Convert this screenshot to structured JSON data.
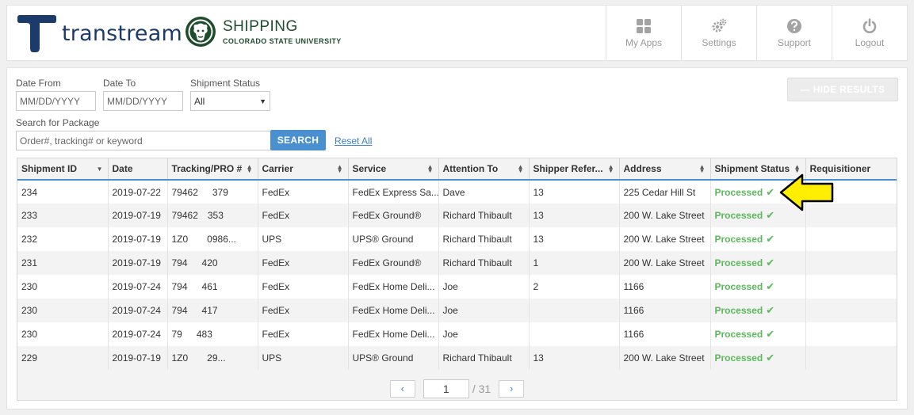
{
  "header": {
    "brand_name": "transtream",
    "org_title": "SHIPPING",
    "org_subtitle": "COLORADO STATE UNIVERSITY",
    "nav": [
      {
        "label": "My Apps",
        "icon": "grid-icon"
      },
      {
        "label": "Settings",
        "icon": "gears-icon"
      },
      {
        "label": "Support",
        "icon": "question-icon"
      },
      {
        "label": "Logout",
        "icon": "power-icon"
      }
    ]
  },
  "filters": {
    "date_from_label": "Date From",
    "date_from_placeholder": "MM/DD/YYYY",
    "date_to_label": "Date To",
    "date_to_placeholder": "MM/DD/YYYY",
    "status_label": "Shipment Status",
    "status_value": "All",
    "search_label": "Search for Package",
    "search_placeholder": "Order#, tracking# or keyword",
    "search_button": "SEARCH",
    "reset_link": "Reset All",
    "hide_results": "— HIDE RESULTS"
  },
  "table": {
    "columns": [
      "Shipment ID",
      "Date",
      "Tracking/PRO #",
      "Carrier",
      "Service",
      "Attention To",
      "Shipper Refer...",
      "Address",
      "Shipment Status",
      "Requisitioner"
    ],
    "rows": [
      {
        "id": "234",
        "date": "2019-07-22",
        "tracking": "79462   379",
        "carrier": "FedEx",
        "service": "FedEx Express Sa...",
        "attention": "Dave   ",
        "shipper_ref": "13  ",
        "address": "225 Cedar Hill St",
        "status": "Processed",
        "requisitioner": ""
      },
      {
        "id": "233",
        "date": "2019-07-19",
        "tracking": "79462  353",
        "carrier": "FedEx",
        "service": "FedEx Ground®",
        "attention": "Richard Thibault",
        "shipper_ref": "13  ",
        "address": "200 W. Lake Street",
        "status": "Processed",
        "requisitioner": ""
      },
      {
        "id": "232",
        "date": "2019-07-19",
        "tracking": "1Z0    0986...",
        "carrier": "UPS",
        "service": "UPS® Ground",
        "attention": "Richard Thibault",
        "shipper_ref": "13  ",
        "address": "200 W. Lake Street",
        "status": "Processed",
        "requisitioner": ""
      },
      {
        "id": "231",
        "date": "2019-07-19",
        "tracking": "794   420",
        "carrier": "FedEx",
        "service": "FedEx Ground®",
        "attention": "Richard Thibault",
        "shipper_ref": "1  ",
        "address": "200 W. Lake Street",
        "status": "Processed",
        "requisitioner": ""
      },
      {
        "id": "230",
        "date": "2019-07-24",
        "tracking": "794   461",
        "carrier": "FedEx",
        "service": "FedEx Home Deli...",
        "attention": "Joe",
        "shipper_ref": "2  ",
        "address": "1166    ",
        "status": "Processed",
        "requisitioner": "  "
      },
      {
        "id": "230",
        "date": "2019-07-24",
        "tracking": "794   417",
        "carrier": "FedEx",
        "service": "FedEx Home Deli...",
        "attention": "Joe",
        "shipper_ref": "",
        "address": "1166    ",
        "status": "Processed",
        "requisitioner": "  "
      },
      {
        "id": "230",
        "date": "2019-07-24",
        "tracking": "79   483",
        "carrier": "FedEx",
        "service": "FedEx Home Deli...",
        "attention": "Joe",
        "shipper_ref": "",
        "address": "1166    ",
        "status": "Processed",
        "requisitioner": "  "
      },
      {
        "id": "229",
        "date": "2019-07-19",
        "tracking": "1Z0    29...",
        "carrier": "UPS",
        "service": "UPS® Ground",
        "attention": "Richard Thibault",
        "shipper_ref": "13  ",
        "address": "200 W. Lake Street",
        "status": "Processed",
        "requisitioner": ""
      }
    ]
  },
  "pagination": {
    "current": "1",
    "total": "/ 31"
  },
  "colors": {
    "accent": "#4a8fd0",
    "status_green": "#5cb85c",
    "brand_navy": "#1b3c6b",
    "csu_green": "#1e4d2b",
    "callout_yellow": "#ffee00"
  }
}
